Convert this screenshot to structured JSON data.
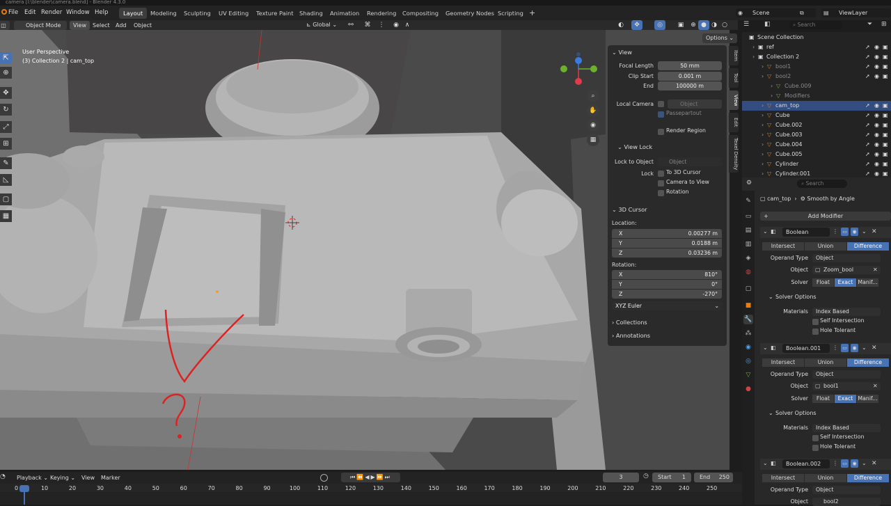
{
  "window_title": "camera [I:\\blender\\camera.blend] - Blender 4.3.0",
  "menus": [
    "File",
    "Edit",
    "Render",
    "Window",
    "Help"
  ],
  "workspaces": [
    "Layout",
    "Modeling",
    "Sculpting",
    "UV Editing",
    "Texture Paint",
    "Shading",
    "Animation",
    "Rendering",
    "Compositing",
    "Geometry Nodes",
    "Scripting"
  ],
  "active_workspace": "Layout",
  "plus": "+",
  "scene": "Scene",
  "view_layer": "ViewLayer",
  "viewport": {
    "mode": "Object Mode",
    "menu": [
      "View",
      "Select",
      "Add",
      "Object"
    ],
    "orientation": "Global",
    "options": "Options",
    "overlay_line1": "User Perspective",
    "overlay_line2": "(3) Collection 2 | cam_top",
    "annotation_question": "?"
  },
  "npanel": {
    "tabs": [
      "Item",
      "Tool",
      "View",
      "Edit",
      "Texel Density"
    ],
    "view_header": "View",
    "focal_length_label": "Focal Length",
    "focal_length": "50 mm",
    "clip_start_label": "Clip Start",
    "clip_start": "0.001 m",
    "end_label": "End",
    "end": "100000 m",
    "local_camera_label": "Local Camera",
    "object_placeholder": "Object",
    "passepartout": "Passepartout",
    "render_region": "Render Region",
    "view_lock_header": "View Lock",
    "lock_to_object_label": "Lock to Object",
    "lock_label": "Lock",
    "to_3d_cursor": "To 3D Cursor",
    "camera_to_view": "Camera to View",
    "rotation_lock": "Rotation",
    "cursor_header": "3D Cursor",
    "location_label": "Location:",
    "x_label": "X",
    "y_label": "Y",
    "z_label": "Z",
    "loc_x": "0.00277 m",
    "loc_y": "0.0188 m",
    "loc_z": "0.03236 m",
    "rotation_label": "Rotation:",
    "rot_x": "810°",
    "rot_y": "0°",
    "rot_z": "-270°",
    "euler": "XYZ Euler",
    "collections": "Collections",
    "annotations": "Annotations"
  },
  "outliner": {
    "search_placeholder": "Search",
    "items": [
      {
        "name": "Scene Collection",
        "indent": 0,
        "color": "#ddd"
      },
      {
        "name": "ref",
        "indent": 1,
        "color": "#ddd"
      },
      {
        "name": "Collection 2",
        "indent": 1,
        "color": "#ddd"
      },
      {
        "name": "bool1",
        "indent": 2,
        "color": "#8a8a8a"
      },
      {
        "name": "bool2",
        "indent": 2,
        "color": "#8a8a8a"
      },
      {
        "name": "Cube.009",
        "indent": 3,
        "color": "#8a8a8a"
      },
      {
        "name": "Modifiers",
        "indent": 3,
        "color": "#8a8a8a"
      },
      {
        "name": "cam_top",
        "indent": 2,
        "color": "#ddd"
      },
      {
        "name": "Cube",
        "indent": 2,
        "color": "#ddd"
      },
      {
        "name": "Cube.002",
        "indent": 2,
        "color": "#ddd"
      },
      {
        "name": "Cube.003",
        "indent": 2,
        "color": "#ddd"
      },
      {
        "name": "Cube.004",
        "indent": 2,
        "color": "#ddd"
      },
      {
        "name": "Cube.005",
        "indent": 2,
        "color": "#ddd"
      },
      {
        "name": "Cylinder",
        "indent": 2,
        "color": "#ddd"
      },
      {
        "name": "Cylinder.001",
        "indent": 2,
        "color": "#ddd"
      }
    ]
  },
  "properties": {
    "search_placeholder": "Search",
    "object": "cam_top",
    "modifier_crumb": "Smooth by Angle",
    "add_modifier": "Add Modifier",
    "ops": [
      "Intersect",
      "Union",
      "Difference"
    ],
    "operand_type_label": "Operand Type",
    "operand_type": "Object",
    "object_label": "Object",
    "solver_label": "Solver",
    "solvers": [
      "Float",
      "Exact",
      "Manif..."
    ],
    "solver_options": "Solver Options",
    "materials_label": "Materials",
    "materials": "Index Based",
    "self_intersection": "Self Intersection",
    "hole_tolerant": "Hole Tolerant",
    "modifiers": [
      {
        "name": "Boolean",
        "object": "Zoom_bool"
      },
      {
        "name": "Boolean.001",
        "object": "bool1"
      },
      {
        "name": "Boolean.002",
        "object": "bool2"
      }
    ]
  },
  "timeline": {
    "menus": [
      "Playback",
      "Keying",
      "View",
      "Marker"
    ],
    "current_frame": "3",
    "start_label": "Start",
    "start": "1",
    "end_label": "End",
    "end": "250",
    "ticks": [
      "0",
      "10",
      "20",
      "30",
      "40",
      "50",
      "60",
      "70",
      "80",
      "90",
      "100",
      "110",
      "120",
      "130",
      "140",
      "150",
      "160",
      "170",
      "180",
      "190",
      "200",
      "210",
      "220",
      "230",
      "240",
      "250"
    ]
  }
}
